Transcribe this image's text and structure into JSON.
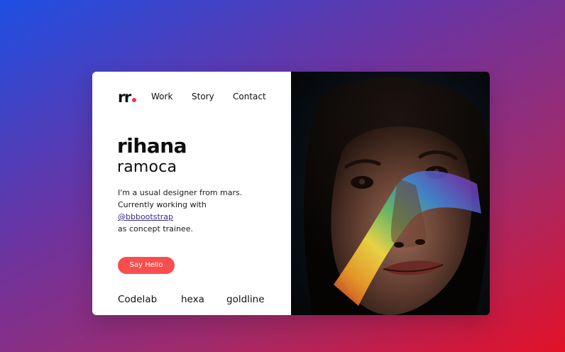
{
  "brand": {
    "logo": "rr",
    "accent": "#e63946"
  },
  "nav": {
    "items": [
      "Work",
      "Story",
      "Contact"
    ]
  },
  "profile": {
    "first_name": "rihana",
    "last_name": "ramoca",
    "bio_line1": "I'm a usual designer from mars.",
    "bio_line2": "Currently working with",
    "bio_link": "@bbbootstrap",
    "bio_line3": "as concept trainee."
  },
  "cta": {
    "label": "Say Hello",
    "color": "#fb4d4d"
  },
  "clients": [
    "Codelab",
    "hexa",
    "goldline"
  ],
  "photo": {
    "subject": "portrait-with-rainbow-light"
  }
}
